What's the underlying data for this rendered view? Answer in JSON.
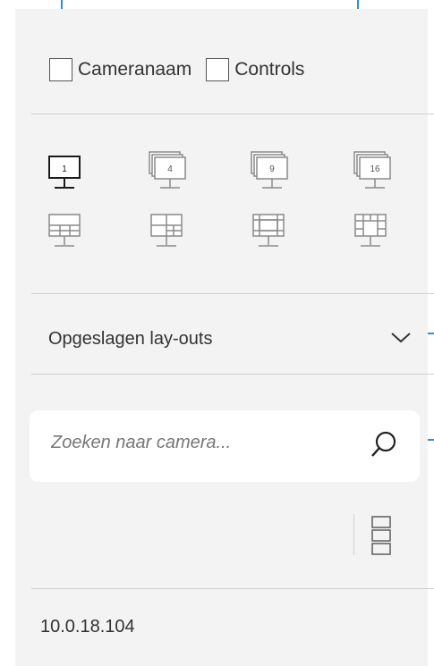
{
  "options": {
    "camera_name_label": "Cameranaam",
    "camera_name_checked": false,
    "controls_label": "Controls",
    "controls_checked": false
  },
  "layout_grid": {
    "single": "1",
    "quad": "4",
    "nine": "9",
    "sixteen": "16"
  },
  "saved_layouts": {
    "label": "Opgeslagen lay-outs"
  },
  "search": {
    "placeholder": "Zoeken naar camera...",
    "value": ""
  },
  "camera_list": {
    "items": [
      "10.0.18.104"
    ]
  },
  "colors": {
    "panel_bg": "#f3f3f3",
    "active_icon": "#1b1b1b",
    "inactive_icon": "#8a8a8a",
    "annotation": "#2f8fd6"
  }
}
